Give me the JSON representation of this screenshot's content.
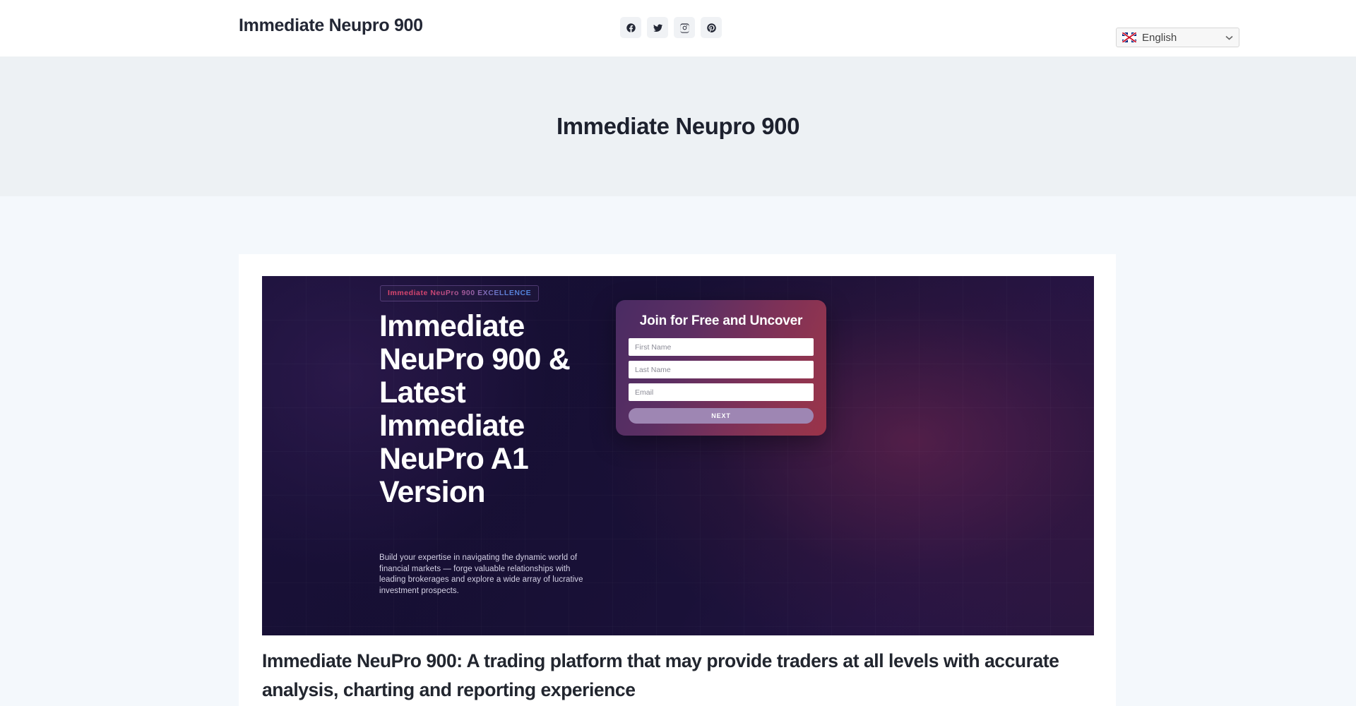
{
  "header": {
    "brand": "Immediate Neupro 900",
    "social": [
      {
        "name": "facebook-icon",
        "label": "Facebook"
      },
      {
        "name": "twitter-icon",
        "label": "Twitter"
      },
      {
        "name": "instagram-icon",
        "label": "Instagram"
      },
      {
        "name": "pinterest-icon",
        "label": "Pinterest"
      }
    ],
    "language": {
      "selected": "English",
      "flag": "uk-flag-icon",
      "chevron": "chevron-down-icon"
    }
  },
  "hero_band": {
    "title": "Immediate Neupro 900"
  },
  "hero_image": {
    "badge": "Immediate NeuPro 900 EXCELLENCE",
    "headline": "Immediate NeuPro 900 & Latest Immediate NeuPro A1 Version",
    "subtext": "Build your expertise in navigating the dynamic world of financial markets — forge valuable relationships with leading brokerages and explore a wide array of lucrative investment prospects.",
    "signup": {
      "title": "Join for Free and Uncover",
      "first_name_placeholder": "First Name",
      "first_name_value": "",
      "last_name_placeholder": "Last Name",
      "last_name_value": "",
      "email_placeholder": "Email",
      "email_value": "",
      "next_label": "NEXT"
    }
  },
  "article": {
    "heading": "Immediate NeuPro 900: A trading platform that may provide traders at all levels with accurate analysis, charting and reporting experience"
  },
  "colors": {
    "page_background": "#f4f8fc",
    "hero_band_background": "#edf1f4",
    "header_background": "#ffffff",
    "text_dark": "#22262f",
    "badge_accent_pink": "#e2486f",
    "badge_accent_blue": "#4f86e0",
    "signup_button": "#9e86b3"
  }
}
